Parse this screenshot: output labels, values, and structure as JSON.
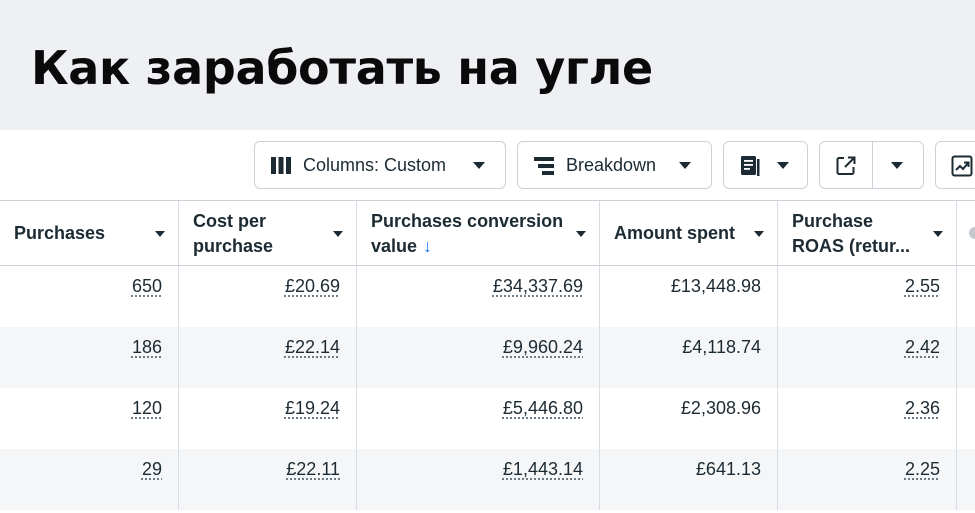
{
  "banner": {
    "title": "Как заработать на угле"
  },
  "toolbar": {
    "columns_label": "Columns: Custom",
    "breakdown_label": "Breakdown"
  },
  "table": {
    "headers": {
      "purchases": "Purchases",
      "cost_per_purchase_l1": "Cost per",
      "cost_per_purchase_l2": "purchase",
      "conv_value_l1": "Purchases conversion",
      "conv_value_l2": "value",
      "conv_value_sort": "↓",
      "amount_spent": "Amount spent",
      "roas_l1": "Purchase",
      "roas_l2": "ROAS (retur..."
    },
    "rows": [
      {
        "purchases": "650",
        "cost": "£20.69",
        "conv_value": "£34,337.69",
        "spent": "£13,448.98",
        "roas": "2.55"
      },
      {
        "purchases": "186",
        "cost": "£22.14",
        "conv_value": "£9,960.24",
        "spent": "£4,118.74",
        "roas": "2.42"
      },
      {
        "purchases": "120",
        "cost": "£19.24",
        "conv_value": "£5,446.80",
        "spent": "£2,308.96",
        "roas": "2.36"
      },
      {
        "purchases": "29",
        "cost": "£22.11",
        "conv_value": "£1,443.14",
        "spent": "£641.13",
        "roas": "2.25"
      }
    ]
  }
}
